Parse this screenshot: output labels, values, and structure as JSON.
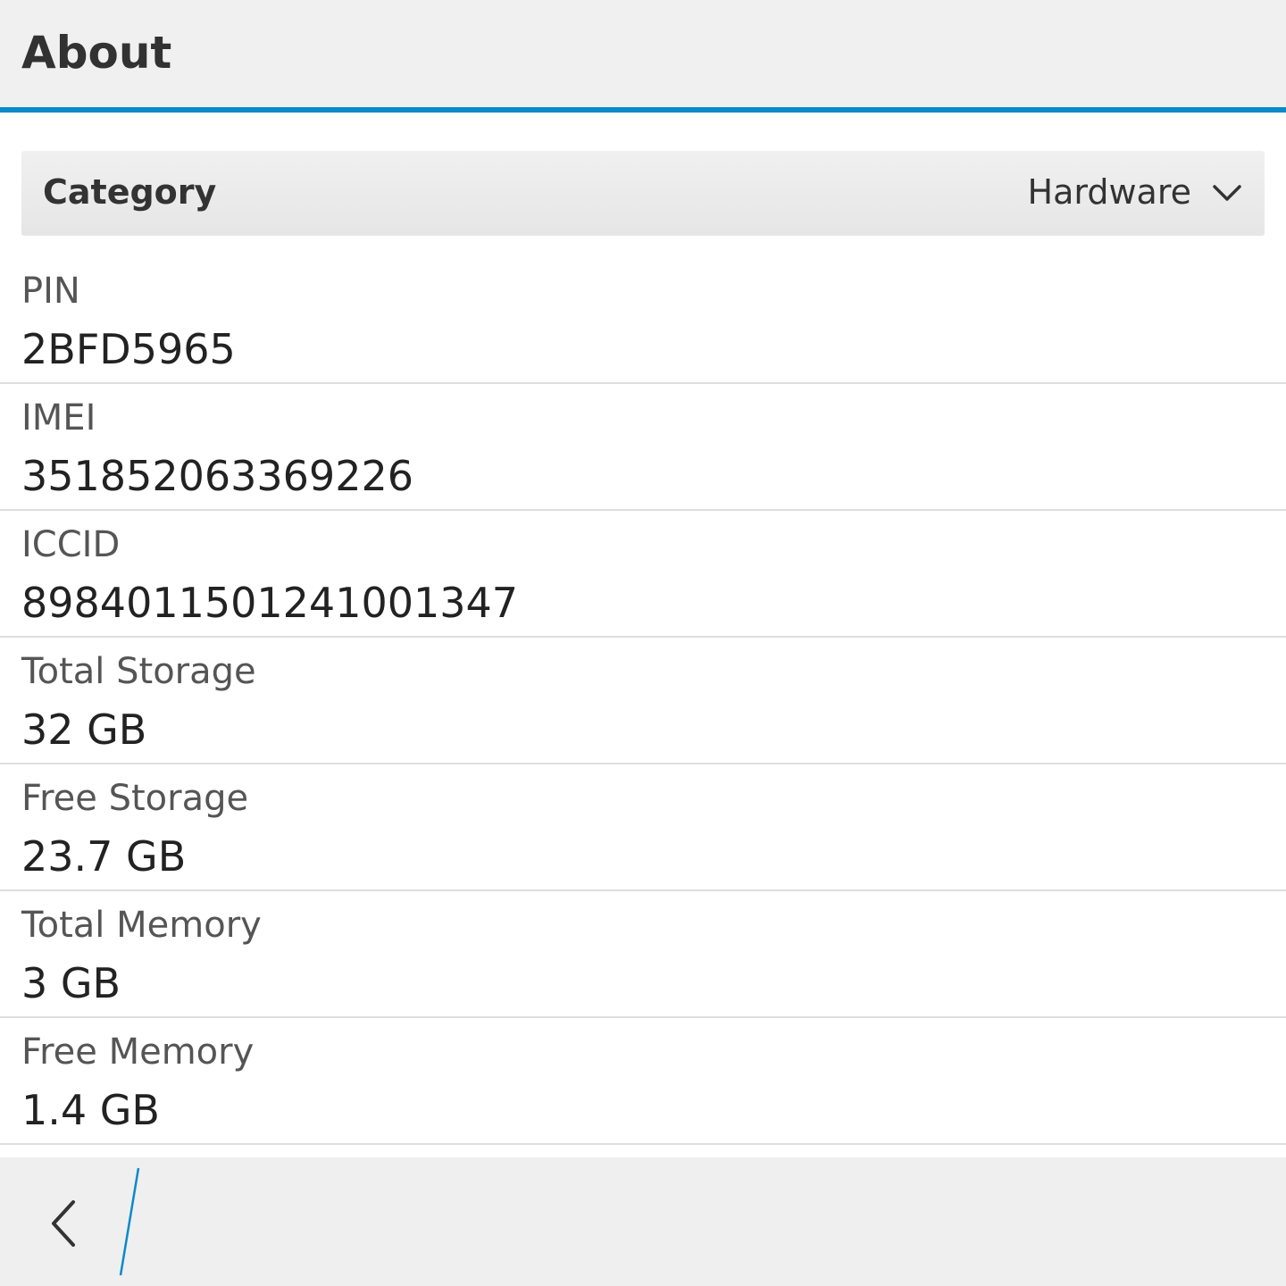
{
  "header": {
    "title": "About"
  },
  "category": {
    "label": "Category",
    "selected": "Hardware"
  },
  "items": [
    {
      "key": "PIN",
      "value": "2BFD5965"
    },
    {
      "key": "IMEI",
      "value": "351852063369226"
    },
    {
      "key": "ICCID",
      "value": "89840115012410013​47"
    },
    {
      "key": "Total Storage",
      "value": "32 GB"
    },
    {
      "key": "Free Storage",
      "value": "23.7 GB"
    },
    {
      "key": "Total Memory",
      "value": "3 GB"
    },
    {
      "key": "Free Memory",
      "value": "1.4 GB"
    }
  ],
  "colors": {
    "accent": "#0a8ac8",
    "bar_background": "#f0f0f0"
  },
  "icons": {
    "dropdown": "chevron-down-icon",
    "back": "chevron-left-icon"
  }
}
